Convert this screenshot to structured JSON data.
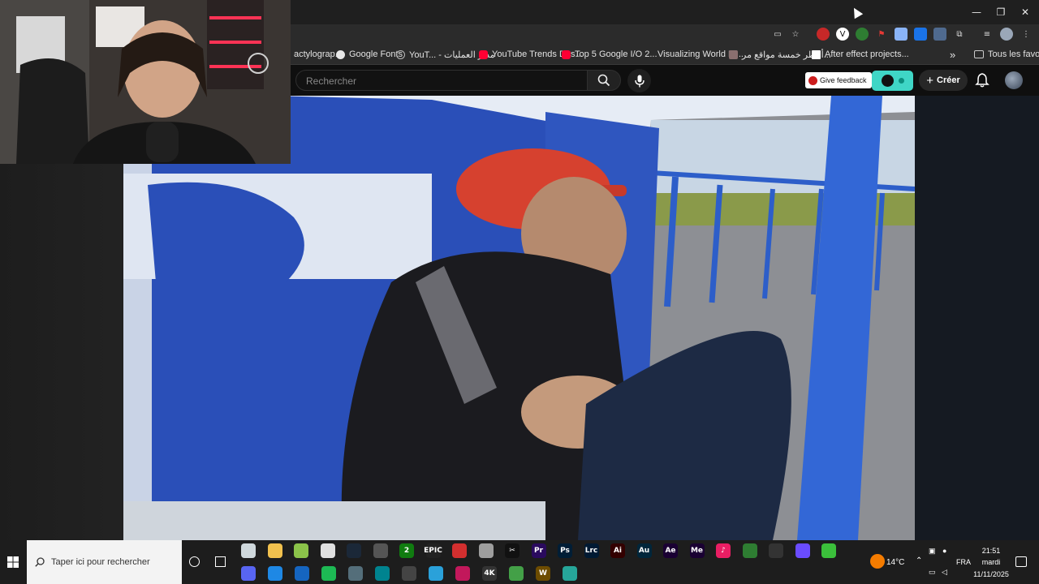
{
  "window": {
    "minimize_glyph": "—",
    "restore_glyph": "❐",
    "close_glyph": "✕"
  },
  "bookmarks": [
    {
      "label": "actylograp...",
      "icon": "page-icon"
    },
    {
      "label": "Google Fonts",
      "icon": "google-icon"
    },
    {
      "label": "YouT... - مدير العمليات",
      "icon": "globe-icon"
    },
    {
      "label": "YouTube Trends Das...",
      "icon": "youtube-icon"
    },
    {
      "label": "Top 5 Google I/O 2...",
      "icon": "youtube-icon"
    },
    {
      "label": "Visualizing World Bi...",
      "icon": "none"
    },
    {
      "label": "أخطر خمسة مواقع مر...",
      "icon": "image-icon"
    },
    {
      "label": "After effect projects...",
      "icon": "page-icon"
    }
  ],
  "bookmarks_overflow": "»",
  "bookmarks_all": "Tous les favoris",
  "youtube": {
    "search_placeholder": "Rechercher",
    "feedback_label": "Give feedback",
    "create_label": "Créer",
    "create_glyph": "+"
  },
  "taskbar": {
    "search_placeholder": "Taper ici pour rechercher",
    "apps_row1": [
      {
        "name": "files-app-icon",
        "label": "",
        "bg": "#cfd8dc"
      },
      {
        "name": "explorer-icon",
        "label": "",
        "bg": "#f2c14e"
      },
      {
        "name": "app-icon-3",
        "label": "",
        "bg": "#8bc34a"
      },
      {
        "name": "chrome-icon",
        "label": "",
        "bg": "#e0e0e0"
      },
      {
        "name": "steam-icon",
        "label": "",
        "bg": "#1b2838"
      },
      {
        "name": "obs-icon",
        "label": "",
        "bg": "#555"
      },
      {
        "name": "xbox-icon",
        "label": "2",
        "bg": "#107c10"
      },
      {
        "name": "epic-games-icon",
        "label": "EPIC",
        "bg": "#222"
      },
      {
        "name": "app-icon-red",
        "label": "",
        "bg": "#d32f2f"
      },
      {
        "name": "app-icon-grey",
        "label": "",
        "bg": "#9e9e9e"
      },
      {
        "name": "capcut-icon",
        "label": "✂",
        "bg": "#111"
      },
      {
        "name": "premiere-icon",
        "label": "Pr",
        "bg": "#2a0a5e"
      },
      {
        "name": "photoshop-icon",
        "label": "Ps",
        "bg": "#001e36"
      },
      {
        "name": "lightroom-icon",
        "label": "Lrc",
        "bg": "#001a33"
      },
      {
        "name": "illustrator-icon",
        "label": "Ai",
        "bg": "#330000"
      },
      {
        "name": "audition-icon",
        "label": "Au",
        "bg": "#00263b"
      },
      {
        "name": "after-effects-icon",
        "label": "Ae",
        "bg": "#1a0033"
      },
      {
        "name": "media-encoder-icon",
        "label": "Me",
        "bg": "#1a0033"
      },
      {
        "name": "tiktok-icon",
        "label": "♪",
        "bg": "#e91e63"
      },
      {
        "name": "app-icon-green",
        "label": "",
        "bg": "#2e7d32"
      },
      {
        "name": "app-icon-dark",
        "label": "",
        "bg": "#333"
      },
      {
        "name": "app-icon-purple",
        "label": "",
        "bg": "#6a4cff"
      },
      {
        "name": "app-icon-lime",
        "label": "",
        "bg": "#3bbf3b"
      }
    ],
    "apps_row2": [
      {
        "name": "discord-icon",
        "label": "",
        "bg": "#5865f2"
      },
      {
        "name": "app-icon-blue",
        "label": "",
        "bg": "#1e88e5"
      },
      {
        "name": "app-icon-bluebird",
        "label": "",
        "bg": "#1565c0"
      },
      {
        "name": "spotify-icon",
        "label": "",
        "bg": "#1db954"
      },
      {
        "name": "app-icon-slate",
        "label": "",
        "bg": "#546e7a"
      },
      {
        "name": "app-icon-cyan",
        "label": "",
        "bg": "#00838f"
      },
      {
        "name": "app-icon-pen",
        "label": "",
        "bg": "#444"
      },
      {
        "name": "telegram-icon",
        "label": "",
        "bg": "#2aa1da"
      },
      {
        "name": "app-icon-pink",
        "label": "",
        "bg": "#c2185b"
      },
      {
        "name": "4k-downloader-icon",
        "label": "4K",
        "bg": "#333"
      },
      {
        "name": "app-icon-leaf",
        "label": "",
        "bg": "#43a047"
      },
      {
        "name": "wow-icon",
        "label": "W",
        "bg": "#6d4c00"
      },
      {
        "name": "app-icon-tiles",
        "label": "",
        "bg": "#26a69a"
      }
    ],
    "weather": "14°C",
    "language": "FRA",
    "time": "21:51",
    "day": "mardi",
    "date": "11/11/2025"
  }
}
